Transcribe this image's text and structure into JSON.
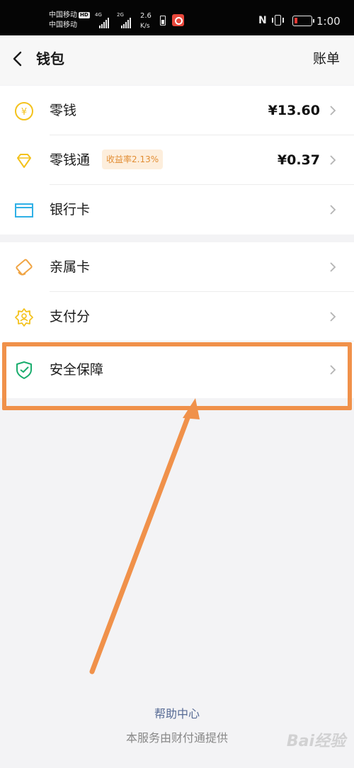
{
  "status_bar": {
    "carrier1": "中国移动",
    "carrier2": "中国移动",
    "hd": "HD",
    "sig1_tag": "4G",
    "sig2_tag": "2G",
    "speed_value": "2.6",
    "speed_unit": "K/s",
    "nfc": "N",
    "time": "1:00"
  },
  "nav": {
    "title": "钱包",
    "right_link": "账单"
  },
  "group1": [
    {
      "label": "零钱",
      "value": "¥13.60",
      "icon": "yuan-coin-icon"
    },
    {
      "label": "零钱通",
      "badge": "收益率2.13%",
      "value": "¥0.37",
      "icon": "diamond-icon"
    },
    {
      "label": "银行卡",
      "icon": "bank-card-icon"
    }
  ],
  "group2": [
    {
      "label": "亲属卡",
      "icon": "family-card-icon"
    },
    {
      "label": "支付分",
      "icon": "pay-score-icon"
    },
    {
      "label": "安全保障",
      "icon": "shield-icon"
    }
  ],
  "footer": {
    "help": "帮助中心",
    "provider": "本服务由财付通提供",
    "watermark": "Bai经验"
  },
  "colors": {
    "accent_yellow": "#f4c21c",
    "card_blue": "#2fb0e6",
    "shield_green": "#1aad6e",
    "family_orange": "#f0a443",
    "annotation_orange": "#f0914a",
    "link_blue": "#576b95"
  }
}
